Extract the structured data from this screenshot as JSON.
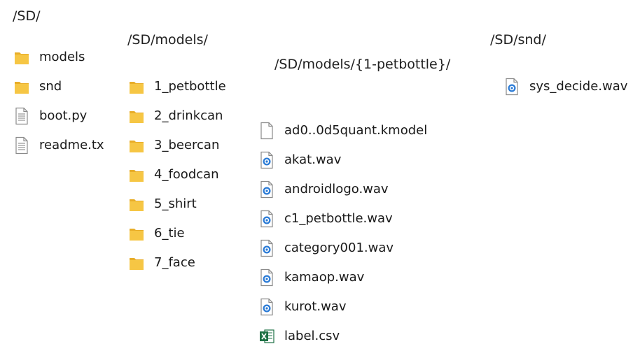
{
  "paths": {
    "root": "/SD/",
    "models": "/SD/models/",
    "petbottle": "/SD/models/{1-petbottle}/",
    "snd": "/SD/snd/"
  },
  "root_items": [
    {
      "icon": "folder-icon",
      "label": "models"
    },
    {
      "icon": "folder-icon",
      "label": "snd"
    },
    {
      "icon": "text-file-icon",
      "label": "boot.py"
    },
    {
      "icon": "text-file-icon",
      "label": "readme.tx"
    }
  ],
  "models_items": [
    {
      "icon": "folder-icon",
      "label": "1_petbottle"
    },
    {
      "icon": "folder-icon",
      "label": "2_drinkcan"
    },
    {
      "icon": "folder-icon",
      "label": "3_beercan"
    },
    {
      "icon": "folder-icon",
      "label": "4_foodcan"
    },
    {
      "icon": "folder-icon",
      "label": "5_shirt"
    },
    {
      "icon": "folder-icon",
      "label": "6_tie"
    },
    {
      "icon": "folder-icon",
      "label": "7_face"
    }
  ],
  "petbottle_items": [
    {
      "icon": "blank-file-icon",
      "label": "ad0..0d5quant.kmodel"
    },
    {
      "icon": "audio-file-icon",
      "label": "akat.wav"
    },
    {
      "icon": "audio-file-icon",
      "label": "androidlogo.wav"
    },
    {
      "icon": "audio-file-icon",
      "label": "c1_petbottle.wav"
    },
    {
      "icon": "audio-file-icon",
      "label": "category001.wav"
    },
    {
      "icon": "audio-file-icon",
      "label": "kamaop.wav"
    },
    {
      "icon": "audio-file-icon",
      "label": "kurot.wav"
    },
    {
      "icon": "excel-file-icon",
      "label": "label.csv"
    }
  ],
  "snd_items": [
    {
      "icon": "audio-file-icon",
      "label": "sys_decide.wav"
    }
  ],
  "colors": {
    "folder": "#f6c644",
    "folder_dark": "#e8ad28",
    "audio": "#2b7bd6",
    "excel": "#1e7145"
  }
}
